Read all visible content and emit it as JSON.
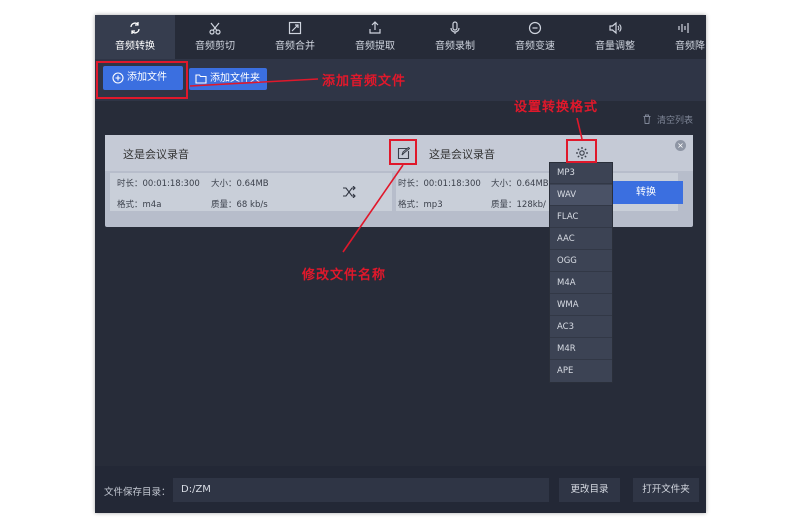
{
  "nav": {
    "tabs": [
      {
        "label": "音频转换",
        "icon": "convert-icon",
        "active": true
      },
      {
        "label": "音频剪切",
        "icon": "scissors-icon"
      },
      {
        "label": "音频合并",
        "icon": "merge-icon"
      },
      {
        "label": "音频提取",
        "icon": "extract-icon"
      },
      {
        "label": "音频录制",
        "icon": "microphone-icon"
      },
      {
        "label": "音频变速",
        "icon": "speed-icon"
      },
      {
        "label": "音量调整",
        "icon": "volume-icon"
      },
      {
        "label": "音频降",
        "icon": "denoise-icon"
      }
    ]
  },
  "toolbar": {
    "add_file": "添加文件",
    "add_folder": "添加文件夹"
  },
  "workspace": {
    "clear_list": "清空列表"
  },
  "file_card": {
    "source": {
      "name": "这是会议录音",
      "duration_label": "时长：",
      "duration": "00:01:18:300",
      "size_label": "大小：",
      "size": "0.64MB",
      "format_label": "格式：",
      "format": "m4a",
      "quality_label": "质量：",
      "quality": "68 kb/s"
    },
    "target": {
      "name": "这是会议录音",
      "duration_label": "时长：",
      "duration": "00:01:18:300",
      "size_label": "大小：",
      "size": "0.64MB",
      "format_label": "格式：",
      "format": "mp3",
      "quality_label": "质量：",
      "quality": "128kb/"
    },
    "convert_button": "转换"
  },
  "format_dropdown": {
    "options": [
      "MP3",
      "WAV",
      "FLAC",
      "AAC",
      "OGG",
      "M4A",
      "WMA",
      "AC3",
      "M4R",
      "APE"
    ],
    "highlighted": "WAV"
  },
  "footer": {
    "save_dir_label": "文件保存目录：",
    "save_dir_value": "D:/ZM",
    "change_dir": "更改目录",
    "open_folder": "打开文件夹"
  },
  "annotations": {
    "add_audio": "添加音频文件",
    "set_format": "设置转换格式",
    "rename": "修改文件名称"
  },
  "colors": {
    "accent": "#3b6fe0",
    "annotation_red": "#e0182b",
    "app_bg": "#2b3140"
  }
}
